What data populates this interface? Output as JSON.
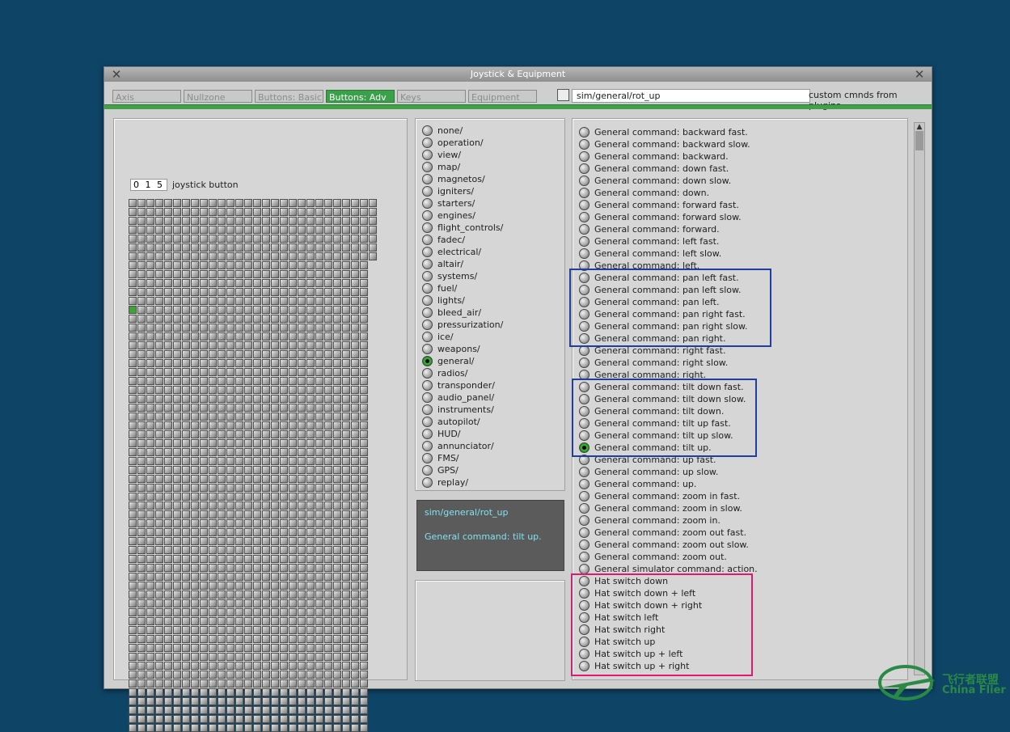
{
  "window": {
    "title": "Joystick & Equipment"
  },
  "tabs": [
    "Axis",
    "Nullzone",
    "Buttons: Basic",
    "Buttons: Adv",
    "Keys",
    "Equipment"
  ],
  "active_tab": "Buttons: Adv",
  "command_field": {
    "value": "sim/general/rot_up"
  },
  "plugins_label": "custom cmnds from plugins",
  "joystick": {
    "button_number": "0 1 5",
    "button_label": "joystick button",
    "checked_index": 15
  },
  "categories": [
    {
      "label": "none/"
    },
    {
      "label": "operation/"
    },
    {
      "label": "view/"
    },
    {
      "label": "map/"
    },
    {
      "label": "magnetos/"
    },
    {
      "label": "igniters/"
    },
    {
      "label": "starters/"
    },
    {
      "label": "engines/"
    },
    {
      "label": "flight_controls/"
    },
    {
      "label": "fadec/"
    },
    {
      "label": "electrical/"
    },
    {
      "label": "altair/"
    },
    {
      "label": "systems/"
    },
    {
      "label": "fuel/"
    },
    {
      "label": "lights/"
    },
    {
      "label": "bleed_air/"
    },
    {
      "label": "pressurization/"
    },
    {
      "label": "ice/"
    },
    {
      "label": "weapons/"
    },
    {
      "label": "general/",
      "selected": true
    },
    {
      "label": "radios/"
    },
    {
      "label": "transponder/"
    },
    {
      "label": "audio_panel/"
    },
    {
      "label": "instruments/"
    },
    {
      "label": "autopilot/"
    },
    {
      "label": "HUD/"
    },
    {
      "label": "annunciator/"
    },
    {
      "label": "FMS/"
    },
    {
      "label": "GPS/"
    },
    {
      "label": "replay/"
    }
  ],
  "info": {
    "path": "sim/general/rot_up",
    "description": "General command: tilt up."
  },
  "commands": [
    {
      "label": "General command: backward fast."
    },
    {
      "label": "General command: backward slow."
    },
    {
      "label": "General command: backward."
    },
    {
      "label": "General command: down fast."
    },
    {
      "label": "General command: down slow."
    },
    {
      "label": "General command: down."
    },
    {
      "label": "General command: forward fast."
    },
    {
      "label": "General command: forward slow."
    },
    {
      "label": "General command: forward."
    },
    {
      "label": "General command: left fast."
    },
    {
      "label": "General command: left slow."
    },
    {
      "label": "General command: left."
    },
    {
      "label": "General command: pan left fast."
    },
    {
      "label": "General command: pan left slow."
    },
    {
      "label": "General command: pan left."
    },
    {
      "label": "General command: pan right fast."
    },
    {
      "label": "General command: pan right slow."
    },
    {
      "label": "General command: pan right."
    },
    {
      "label": "General command: right fast."
    },
    {
      "label": "General command: right slow."
    },
    {
      "label": "General command: right."
    },
    {
      "label": "General command: tilt down fast."
    },
    {
      "label": "General command: tilt down slow."
    },
    {
      "label": "General command: tilt down."
    },
    {
      "label": "General command: tilt up fast."
    },
    {
      "label": "General command: tilt up slow."
    },
    {
      "label": "General command: tilt up.",
      "selected": true
    },
    {
      "label": "General command: up fast."
    },
    {
      "label": "General command: up slow."
    },
    {
      "label": "General command: up."
    },
    {
      "label": "General command: zoom in fast."
    },
    {
      "label": "General command: zoom in slow."
    },
    {
      "label": "General command: zoom in."
    },
    {
      "label": "General command: zoom out fast."
    },
    {
      "label": "General command: zoom out slow."
    },
    {
      "label": "General command: zoom out."
    },
    {
      "label": "General simulator command: action."
    },
    {
      "label": "Hat switch down"
    },
    {
      "label": "Hat switch down + left"
    },
    {
      "label": "Hat switch down + right"
    },
    {
      "label": "Hat switch left"
    },
    {
      "label": "Hat switch right"
    },
    {
      "label": "Hat switch up"
    },
    {
      "label": "Hat switch up + left"
    },
    {
      "label": "Hat switch up + right"
    }
  ],
  "watermark": {
    "zh": "飞行者联盟",
    "en": "China Flier"
  },
  "icons": {
    "close": "close-icon",
    "scroll_up": "arrow-up-icon"
  },
  "colors": {
    "desktop": "#0e4466",
    "accent_green": "#43a047",
    "highlight_blue": "#1f3fa0",
    "highlight_pink": "#e0196e",
    "info_text": "#7de3ef"
  }
}
